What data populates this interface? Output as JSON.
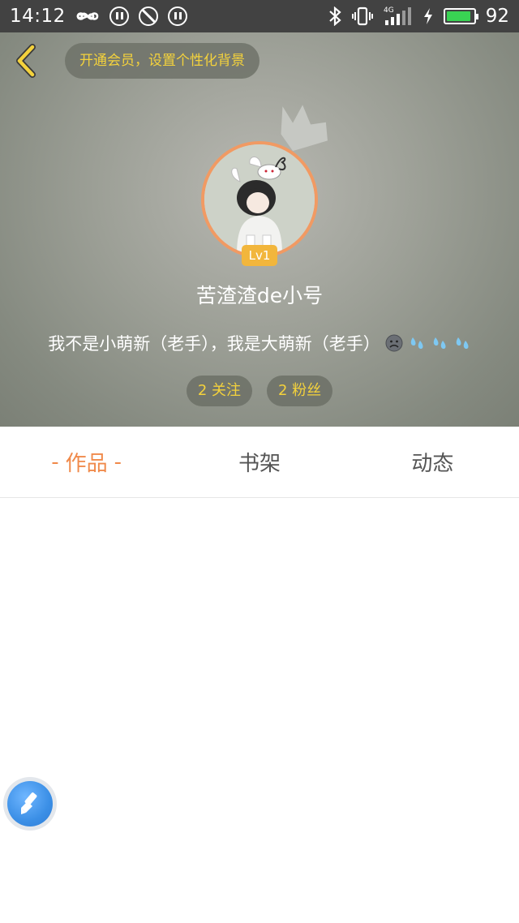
{
  "status_bar": {
    "time": "14:12",
    "network": "4G",
    "battery": "92",
    "battery_level": 0.92,
    "icons": [
      "infinity-icon",
      "pause-icon",
      "block-icon",
      "pause-icon",
      "bluetooth-icon",
      "vibrate-icon",
      "signal-icon",
      "charging-icon",
      "battery-icon"
    ]
  },
  "header": {
    "vip_banner": "开通会员，设置个性化背景",
    "username": "苦渣渣de小号",
    "level": "Lv1",
    "bio": "我不是小萌新（老手），我是大萌新（老手）",
    "stats": {
      "following": "2 关注",
      "followers": "2 粉丝"
    }
  },
  "tabs": [
    {
      "label": "作品",
      "active": true
    },
    {
      "label": "书架",
      "active": false
    },
    {
      "label": "动态",
      "active": false
    }
  ],
  "colors": {
    "accent_orange": "#f08a4b",
    "gold": "#f4d23c",
    "level_badge": "#f2b63c",
    "float_button": "#3b8fe6"
  }
}
